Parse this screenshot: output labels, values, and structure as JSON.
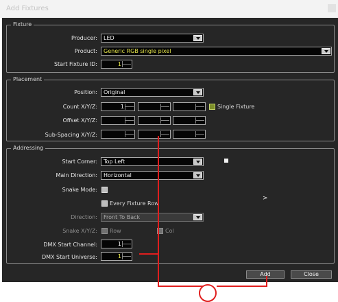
{
  "window": {
    "title": "Add Fixtures"
  },
  "fixture": {
    "group_title": "Fixture",
    "producer_label": "Producer:",
    "producer_value": "LED",
    "product_label": "Product:",
    "product_value": "Generic RGB single pixel",
    "start_id_label": "Start Fixture ID:",
    "start_id_value": "1"
  },
  "placement": {
    "group_title": "Placement",
    "position_label": "Position:",
    "position_value": "Original",
    "count_label": "Count X/Y/Z:",
    "count_values": [
      "1",
      "",
      ""
    ],
    "offset_label": "Offset X/Y/Z:",
    "offset_values": [
      "",
      "",
      ""
    ],
    "spacing_label": "Sub-Spacing X/Y/Z:",
    "spacing_values": [
      "",
      "",
      ""
    ],
    "single_fixture_label": "Single Fixture"
  },
  "addressing": {
    "group_title": "Addressing",
    "start_corner_label": "Start Corner:",
    "start_corner_value": "Top Left",
    "main_direction_label": "Main Direction:",
    "main_direction_value": "Horizontal",
    "snake_label": "Snake Mode:",
    "every_fixture_label": "Every Fixture Row",
    "direction_label": "Direction:",
    "direction_value": "Front To Back",
    "snake_xy_label": "Snake X/Y/Z:",
    "snake_x_label": "Row",
    "snake_y_label": "Col",
    "dmx_start_label": "DMX Start Channel:",
    "dmx_start_value": "1",
    "dmx_universe_label": "DMX Start Universe:",
    "dmx_universe_value": "1"
  },
  "buttons": {
    "add": "Add",
    "close": "Close"
  },
  "overlay": {
    "ghost_arrow": ">"
  },
  "colors": {
    "annotation": "#e01e1e",
    "dialog_bg": "#262626",
    "accent_yellow": "#e6e64a"
  }
}
